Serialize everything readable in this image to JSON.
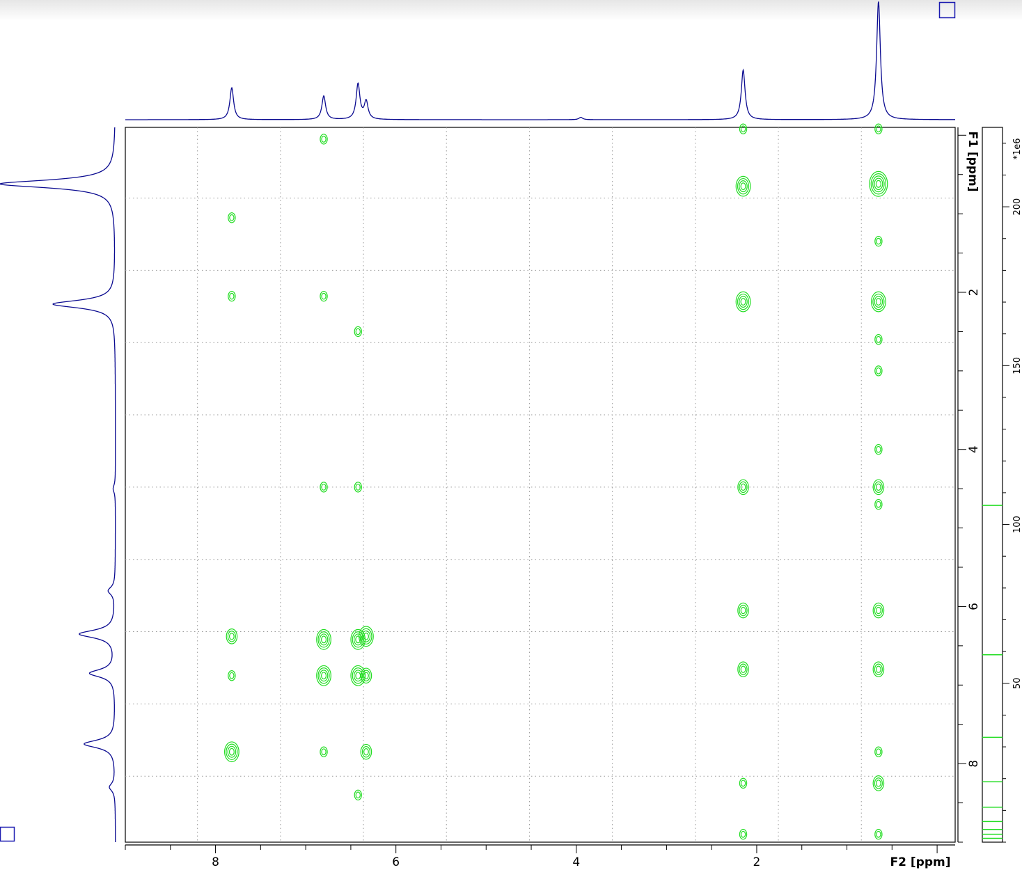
{
  "chart_data": {
    "type": "contour",
    "xlabel": "F2 [ppm]",
    "ylabel": "F1 [ppm]",
    "x_axis": {
      "range": [
        9.0,
        -0.2
      ],
      "reversed": true,
      "tick_labels": [
        "8",
        "6",
        "4",
        "2"
      ],
      "major_ticks": [
        8,
        6,
        4,
        2
      ],
      "grid_lines": [
        8.2,
        7.28,
        6.36,
        5.44,
        4.52,
        3.6,
        2.68,
        1.76,
        0.84
      ]
    },
    "y_axis": {
      "range": [
        -0.1,
        9.0
      ],
      "tick_labels": [
        "2",
        "4",
        "6",
        "8"
      ],
      "major_ticks": [
        2,
        4,
        6,
        8
      ],
      "grid_lines": [
        0.8,
        1.72,
        2.64,
        3.56,
        4.48,
        5.4,
        6.32,
        7.24,
        8.16
      ]
    },
    "grid": true,
    "contour_color": "#22dd22",
    "spectrum_color": "#0a0a90",
    "f2_projection_peaks": [
      {
        "x": 7.82,
        "height": 0.27
      },
      {
        "x": 6.8,
        "height": 0.2
      },
      {
        "x": 6.42,
        "height": 0.3
      },
      {
        "x": 6.33,
        "height": 0.15
      },
      {
        "x": 2.15,
        "height": 0.42
      },
      {
        "x": 0.65,
        "height": 1.0
      },
      {
        "x": 3.95,
        "height": 0.02
      }
    ],
    "f1_projection_peaks": [
      {
        "y": 0.62,
        "height": 1.0
      },
      {
        "y": 2.15,
        "height": 0.54
      },
      {
        "y": 6.35,
        "height": 0.31
      },
      {
        "y": 6.85,
        "height": 0.22
      },
      {
        "y": 7.75,
        "height": 0.27
      },
      {
        "y": 8.3,
        "height": 0.05
      },
      {
        "y": 5.8,
        "height": 0.06
      },
      {
        "y": 4.5,
        "height": 0.02
      }
    ],
    "cross_peaks": [
      {
        "x": 6.8,
        "y": 0.05,
        "size": 1
      },
      {
        "x": 2.15,
        "y": -0.08,
        "size": 1
      },
      {
        "x": 0.65,
        "y": -0.08,
        "size": 1
      },
      {
        "x": 2.15,
        "y": 0.65,
        "size": 3
      },
      {
        "x": 0.65,
        "y": 0.62,
        "size": 4
      },
      {
        "x": 7.82,
        "y": 1.05,
        "size": 1
      },
      {
        "x": 0.65,
        "y": 1.35,
        "size": 1
      },
      {
        "x": 7.82,
        "y": 2.05,
        "size": 1
      },
      {
        "x": 6.8,
        "y": 2.05,
        "size": 1
      },
      {
        "x": 2.15,
        "y": 2.12,
        "size": 3
      },
      {
        "x": 0.65,
        "y": 2.12,
        "size": 3
      },
      {
        "x": 6.42,
        "y": 2.5,
        "size": 1
      },
      {
        "x": 0.65,
        "y": 2.6,
        "size": 1
      },
      {
        "x": 0.65,
        "y": 3.0,
        "size": 1
      },
      {
        "x": 0.65,
        "y": 4.0,
        "size": 1
      },
      {
        "x": 6.8,
        "y": 4.48,
        "size": 1
      },
      {
        "x": 6.42,
        "y": 4.48,
        "size": 1
      },
      {
        "x": 2.15,
        "y": 4.48,
        "size": 2
      },
      {
        "x": 0.65,
        "y": 4.48,
        "size": 2
      },
      {
        "x": 0.65,
        "y": 4.7,
        "size": 1
      },
      {
        "x": 2.15,
        "y": 6.05,
        "size": 2
      },
      {
        "x": 0.65,
        "y": 6.05,
        "size": 2
      },
      {
        "x": 7.82,
        "y": 6.38,
        "size": 2
      },
      {
        "x": 6.8,
        "y": 6.42,
        "size": 3
      },
      {
        "x": 6.42,
        "y": 6.42,
        "size": 3
      },
      {
        "x": 6.33,
        "y": 6.38,
        "size": 3
      },
      {
        "x": 7.82,
        "y": 6.88,
        "size": 1
      },
      {
        "x": 6.8,
        "y": 6.88,
        "size": 3
      },
      {
        "x": 6.42,
        "y": 6.88,
        "size": 3
      },
      {
        "x": 6.33,
        "y": 6.88,
        "size": 2
      },
      {
        "x": 2.15,
        "y": 6.8,
        "size": 2
      },
      {
        "x": 0.65,
        "y": 6.8,
        "size": 2
      },
      {
        "x": 7.82,
        "y": 7.85,
        "size": 3
      },
      {
        "x": 6.8,
        "y": 7.85,
        "size": 1
      },
      {
        "x": 6.33,
        "y": 7.85,
        "size": 2
      },
      {
        "x": 0.65,
        "y": 7.85,
        "size": 1
      },
      {
        "x": 2.15,
        "y": 8.25,
        "size": 1
      },
      {
        "x": 0.65,
        "y": 8.25,
        "size": 2
      },
      {
        "x": 6.42,
        "y": 8.4,
        "size": 1
      },
      {
        "x": 2.15,
        "y": 8.9,
        "size": 1
      },
      {
        "x": 0.65,
        "y": 8.9,
        "size": 1
      }
    ],
    "intensity_scale": {
      "label": "*1e6",
      "tick_labels": [
        "200",
        "150",
        "100",
        "50"
      ],
      "range": [
        0,
        225
      ],
      "ticks": [
        200,
        150,
        100,
        50
      ],
      "contour_levels": [
        106,
        59,
        33,
        19,
        11,
        6.5,
        4,
        2.5,
        1.2
      ]
    }
  }
}
